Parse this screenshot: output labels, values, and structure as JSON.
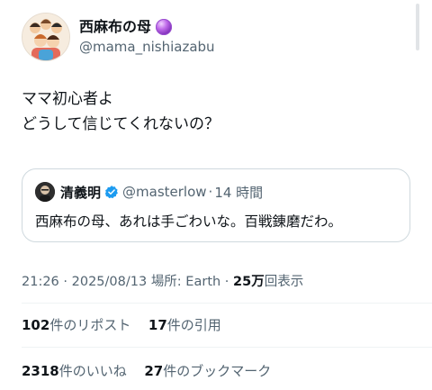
{
  "author": {
    "display_name": "西麻布の母",
    "handle": "@mama_nishiazabu",
    "badge_icon": "purple-orb-icon"
  },
  "tweet": {
    "lines": [
      "ママ初心者よ",
      "どうして信じてくれないの？"
    ]
  },
  "quote": {
    "name": "清義明",
    "handle": "@masterlow",
    "separator": "·",
    "time": "14 時間",
    "text": "西麻布の母、あれは手ごわいな。百戦錬磨だわ。",
    "verified_color": "#1d9bf0"
  },
  "meta": {
    "time": "21:26",
    "sep1": " · ",
    "date": "2025/08/13",
    "location": "場所: Earth",
    "sep2": " · ",
    "views_count": "25万",
    "views_label": "回表示"
  },
  "stats": {
    "reposts_count": "102",
    "reposts_label": "件のリポスト",
    "quotes_count": "17",
    "quotes_label": "件の引用",
    "likes_count": "2318",
    "likes_label": "件のいいね",
    "bookmarks_count": "27",
    "bookmarks_label": "件のブックマーク"
  },
  "colors": {
    "text": "#0f1419",
    "secondary": "#536471",
    "border": "#cfd9de",
    "accent": "#1d9bf0"
  }
}
